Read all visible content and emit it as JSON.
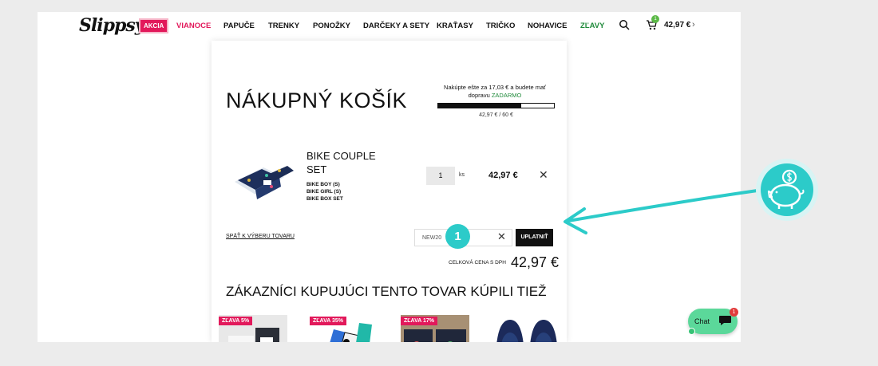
{
  "header": {
    "logo": "Slippsy",
    "nav": [
      {
        "label": "AKCIA",
        "style": "badge"
      },
      {
        "label": "VIANOCE",
        "style": "red"
      },
      {
        "label": "PAPUČE",
        "style": "normal"
      },
      {
        "label": "TRENKY",
        "style": "normal"
      },
      {
        "label": "PONOŽKY",
        "style": "normal"
      },
      {
        "label": "DARČEKY A SETY",
        "style": "normal"
      },
      {
        "label": "KRAŤASY",
        "style": "normal"
      },
      {
        "label": "TRIČKO",
        "style": "normal"
      },
      {
        "label": "NOHAVICE",
        "style": "normal"
      },
      {
        "label": "ZĽAVY",
        "style": "green"
      }
    ],
    "cart_count": "1",
    "cart_total": "42,97 €",
    "cart_chevron": "›"
  },
  "cart": {
    "title": "NÁKUPNÝ KOŠÍK",
    "shipping_message": "Nakúpte ešte za 17,03 € a budete mať dopravu",
    "shipping_free": "ZADARMO",
    "progress_fraction": 0.716,
    "progress_text": "42,97 € / 60 €",
    "item": {
      "name": "BIKE COUPLE SET",
      "subitems": [
        "BIKE BOY (S)",
        "BIKE GIRL (S)",
        "BIKE BOX SET"
      ],
      "quantity": "1",
      "unit": "ks",
      "price": "42,97 €",
      "remove": "✕"
    },
    "back_link": "SPÄŤ K VÝBERU TOVARU",
    "coupon": {
      "value": "NEW20",
      "clear": "✕",
      "apply_label": "UPLATNIŤ"
    },
    "step_marker": "1",
    "total_label": "CELKOVÁ CENA S DPH",
    "total_value": "42,97 €"
  },
  "recommendations": {
    "title": "ZÁKAZNÍCI KUPUJÚCI TENTO TOVAR KÚPILI TIEŽ",
    "items": [
      {
        "badge": "ZĽAVA 5%"
      },
      {
        "badge": "ZĽAVA 35%"
      },
      {
        "badge": "ZĽAVA 17%"
      },
      {
        "badge": ""
      }
    ]
  },
  "chat": {
    "label": "Chat",
    "badge": "1"
  },
  "colors": {
    "accent": "#e2195b",
    "teal": "#2ccbc9",
    "green": "#1f8a3a",
    "chat": "#5bd89a"
  },
  "icons": [
    "search-icon",
    "cart-icon",
    "close-icon",
    "piggy-bank-icon",
    "chat-icon"
  ]
}
